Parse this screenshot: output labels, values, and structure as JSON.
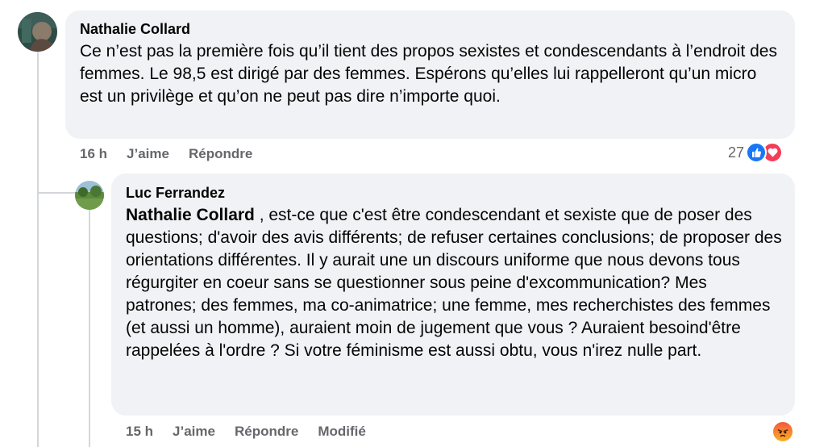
{
  "comment": {
    "author": "Nathalie Collard",
    "text": "Ce n’est pas la première fois qu’il tient des propos sexistes et condescendants à l’endroit des femmes. Le 98,5 est dirigé par des femmes. Espérons qu’elles lui rappelleront qu’un micro est un privilège et qu’on ne peut pas dire n’importe quoi.",
    "time": "16 h",
    "like_label": "J’aime",
    "reply_label": "Répondre",
    "reaction_count": "27",
    "reaction_icons": [
      "like-icon",
      "love-icon"
    ],
    "colors": {
      "like": "#1877f2",
      "love": "#f33e58"
    }
  },
  "reply": {
    "author": "Luc Ferrandez",
    "mention": "Nathalie Collard",
    "text": " , est-ce que c'est être condescendant et sexiste que de poser des questions; d'avoir des avis différents; de refuser certaines conclusions; de proposer des orientations différentes. Il y aurait une un discours uniforme que nous devons tous régurgiter en coeur sans se questionner sous peine d'excommunication? Mes patrones; des femmes, ma co-animatrice; une femme, mes recherchistes des femmes (et aussi un homme), auraient moin de jugement que vous ? Auraient besoind'être rappelées à l'ordre ? Si votre féminisme est aussi obtu, vous n'irez nulle part.",
    "time": "15 h",
    "like_label": "J’aime",
    "reply_label": "Répondre",
    "edited_label": "Modifié",
    "reaction_icons": [
      "angry-icon"
    ]
  },
  "colors": {
    "bubble_bg": "#f0f2f5",
    "meta_text": "#65676b",
    "thread_line": "#d3d6db"
  }
}
